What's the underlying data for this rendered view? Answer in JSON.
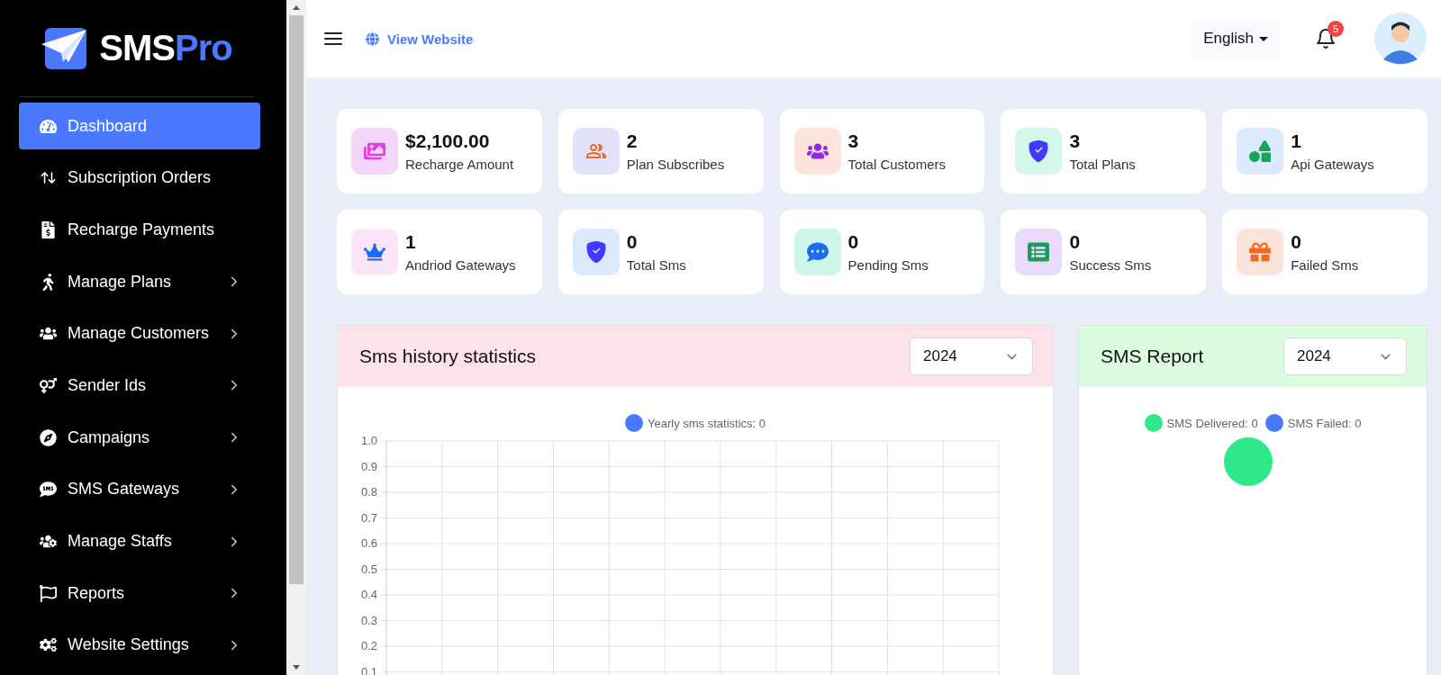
{
  "brand": {
    "name_main": "SMS",
    "name_accent": "Pro"
  },
  "sidebar": {
    "items": [
      {
        "label": "Dashboard",
        "selected": true,
        "expandable": false
      },
      {
        "label": "Subscription Orders",
        "selected": false,
        "expandable": false
      },
      {
        "label": "Recharge Payments",
        "selected": false,
        "expandable": false
      },
      {
        "label": "Manage Plans",
        "selected": false,
        "expandable": true
      },
      {
        "label": "Manage Customers",
        "selected": false,
        "expandable": true
      },
      {
        "label": "Sender Ids",
        "selected": false,
        "expandable": true
      },
      {
        "label": "Campaigns",
        "selected": false,
        "expandable": true
      },
      {
        "label": "SMS Gateways",
        "selected": false,
        "expandable": true
      },
      {
        "label": "Manage Staffs",
        "selected": false,
        "expandable": true
      },
      {
        "label": "Reports",
        "selected": false,
        "expandable": true
      },
      {
        "label": "Website Settings",
        "selected": false,
        "expandable": true
      }
    ]
  },
  "topbar": {
    "view_website": "View Website",
    "language": "English",
    "notification_count": "5"
  },
  "stats": [
    {
      "value": "$2,100.00",
      "label": "Recharge Amount",
      "color": "#e23ee6"
    },
    {
      "value": "2",
      "label": "Plan Subscribes",
      "color": "#f26b1d"
    },
    {
      "value": "3",
      "label": "Total Customers",
      "color": "#8b2be2"
    },
    {
      "value": "3",
      "label": "Total Plans",
      "color": "#4338ff"
    },
    {
      "value": "1",
      "label": "Api Gateways",
      "color": "#18a55a"
    },
    {
      "value": "1",
      "label": "Andriod Gateways",
      "color": "#1d6cf0"
    },
    {
      "value": "0",
      "label": "Total Sms",
      "color": "#4338ff"
    },
    {
      "value": "0",
      "label": "Pending Sms",
      "color": "#1d6cf0"
    },
    {
      "value": "0",
      "label": "Success Sms",
      "color": "#1a9e5c"
    },
    {
      "value": "0",
      "label": "Failed Sms",
      "color": "#f26b1d"
    }
  ],
  "history_panel": {
    "title": "Sms history statistics",
    "year": "2024",
    "chart_data": {
      "type": "line",
      "series": [
        {
          "name": "Yearly sms statistics: 0",
          "color": "#4a78ff"
        }
      ],
      "ylim": [
        0,
        1
      ],
      "grid": true,
      "yticks": [
        {
          "value": 1,
          "label": "1.0"
        },
        {
          "value": 0.9,
          "label": "0.9"
        },
        {
          "value": 0.8,
          "label": "0.8"
        },
        {
          "value": 0.7,
          "label": "0.7"
        },
        {
          "value": 0.6,
          "label": "0.6"
        },
        {
          "value": 0.5,
          "label": "0.5"
        },
        {
          "value": 0.4,
          "label": "0.4"
        },
        {
          "value": 0.3,
          "label": "0.3"
        },
        {
          "value": 0.2,
          "label": "0.2"
        },
        {
          "value": 0.1,
          "label": "0.1"
        }
      ]
    }
  },
  "report_panel": {
    "title": "SMS Report",
    "year": "2024",
    "legend": [
      {
        "label": "SMS Delivered: 0",
        "color": "#2ee88a"
      },
      {
        "label": "SMS Failed: 0",
        "color": "#4a78ff"
      }
    ]
  }
}
